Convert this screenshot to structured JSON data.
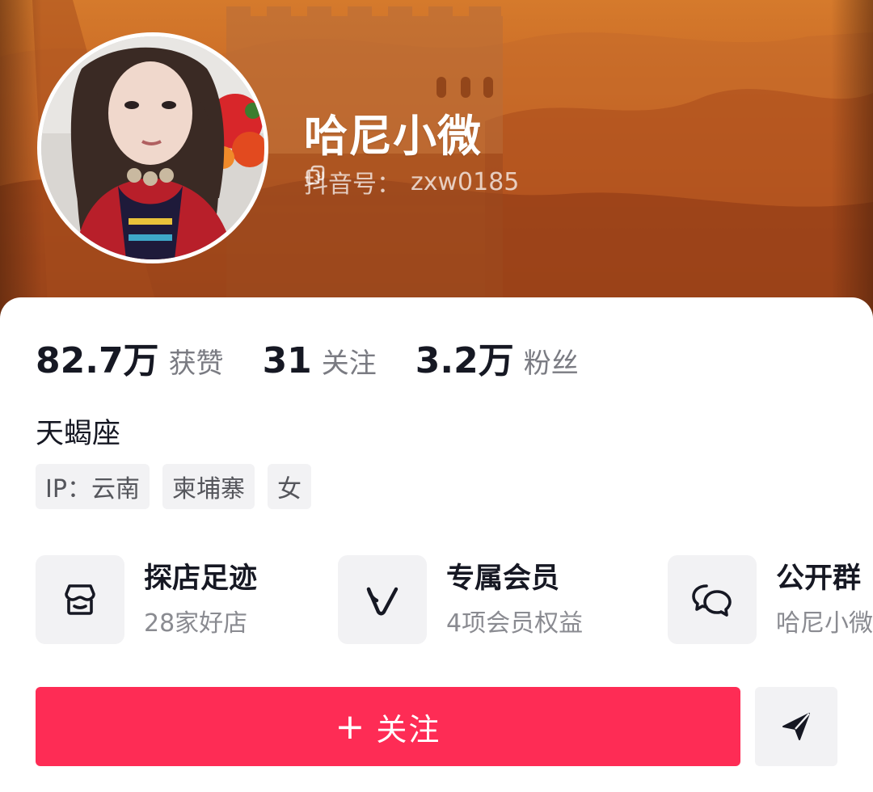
{
  "profile": {
    "username": "哈尼小微",
    "douyin_id_label": "抖音号：",
    "douyin_id": "zxw0185"
  },
  "stats": [
    {
      "value": "82.7万",
      "label": "获赞"
    },
    {
      "value": "31",
      "label": "关注"
    },
    {
      "value": "3.2万",
      "label": "粉丝"
    }
  ],
  "bio": "天蝎座",
  "tags": [
    "IP：云南",
    "柬埔寨",
    "女"
  ],
  "features": [
    {
      "title": "探店足迹",
      "subtitle": "28家好店",
      "icon": "store-icon"
    },
    {
      "title": "专属会员",
      "subtitle": "4项会员权益",
      "icon": "vip-v-icon"
    },
    {
      "title": "公开群",
      "subtitle": "哈尼小微",
      "icon": "chat-bubbles-icon"
    }
  ],
  "actions": {
    "follow_plus": "+",
    "follow_label": "关注",
    "share_icon": "send-icon"
  },
  "colors": {
    "accent": "#fe2c55",
    "text_primary": "#161823",
    "text_secondary": "#7a7b82",
    "tag_bg": "#f2f2f4",
    "banner": "#b2521c"
  }
}
